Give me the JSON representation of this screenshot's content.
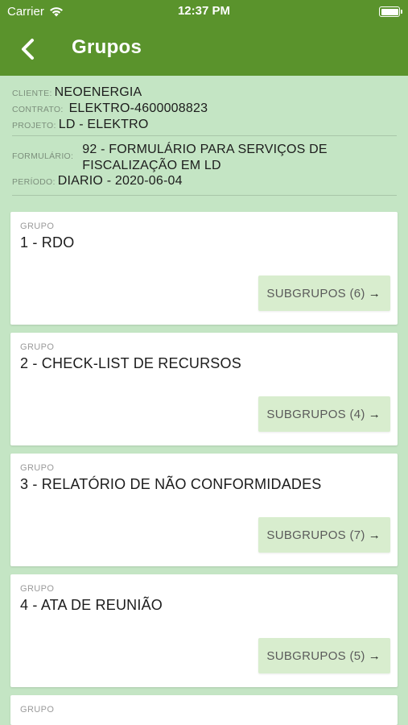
{
  "status_bar": {
    "carrier": "Carrier",
    "time": "12:37 PM",
    "battery_level": 1.0
  },
  "nav": {
    "title": "Grupos"
  },
  "info": {
    "cliente_label": "CLIENTE:",
    "cliente": "NEOENERGIA",
    "contrato_label": "CONTRATO:",
    "contrato": "ELEKTRO-4600008823",
    "projeto_label": "PROJETO:",
    "projeto": "LD - ELEKTRO",
    "formulario_label": "FORMULÁRIO:",
    "formulario_line1": "92 - FORMULÁRIO PARA SERVIÇOS DE",
    "formulario_line2": "FISCALIZAÇÃO EM LD",
    "periodo_label": "PERÍODO:",
    "periodo": "DIARIO - 2020-06-04"
  },
  "groups": [
    {
      "label": "GRUPO",
      "name": "1 - RDO",
      "button": "SUBGRUPOS (6)"
    },
    {
      "label": "GRUPO",
      "name": "2 - CHECK-LIST DE RECURSOS",
      "button": "SUBGRUPOS (4)"
    },
    {
      "label": "GRUPO",
      "name": "3 - RELATÓRIO DE NÃO CONFORMIDADES",
      "button": "SUBGRUPOS (7)"
    },
    {
      "label": "GRUPO",
      "name": "4 - ATA DE REUNIÃO",
      "button": "SUBGRUPOS (5)"
    },
    {
      "label": "GRUPO"
    }
  ],
  "icons": {
    "arrow": "→"
  }
}
